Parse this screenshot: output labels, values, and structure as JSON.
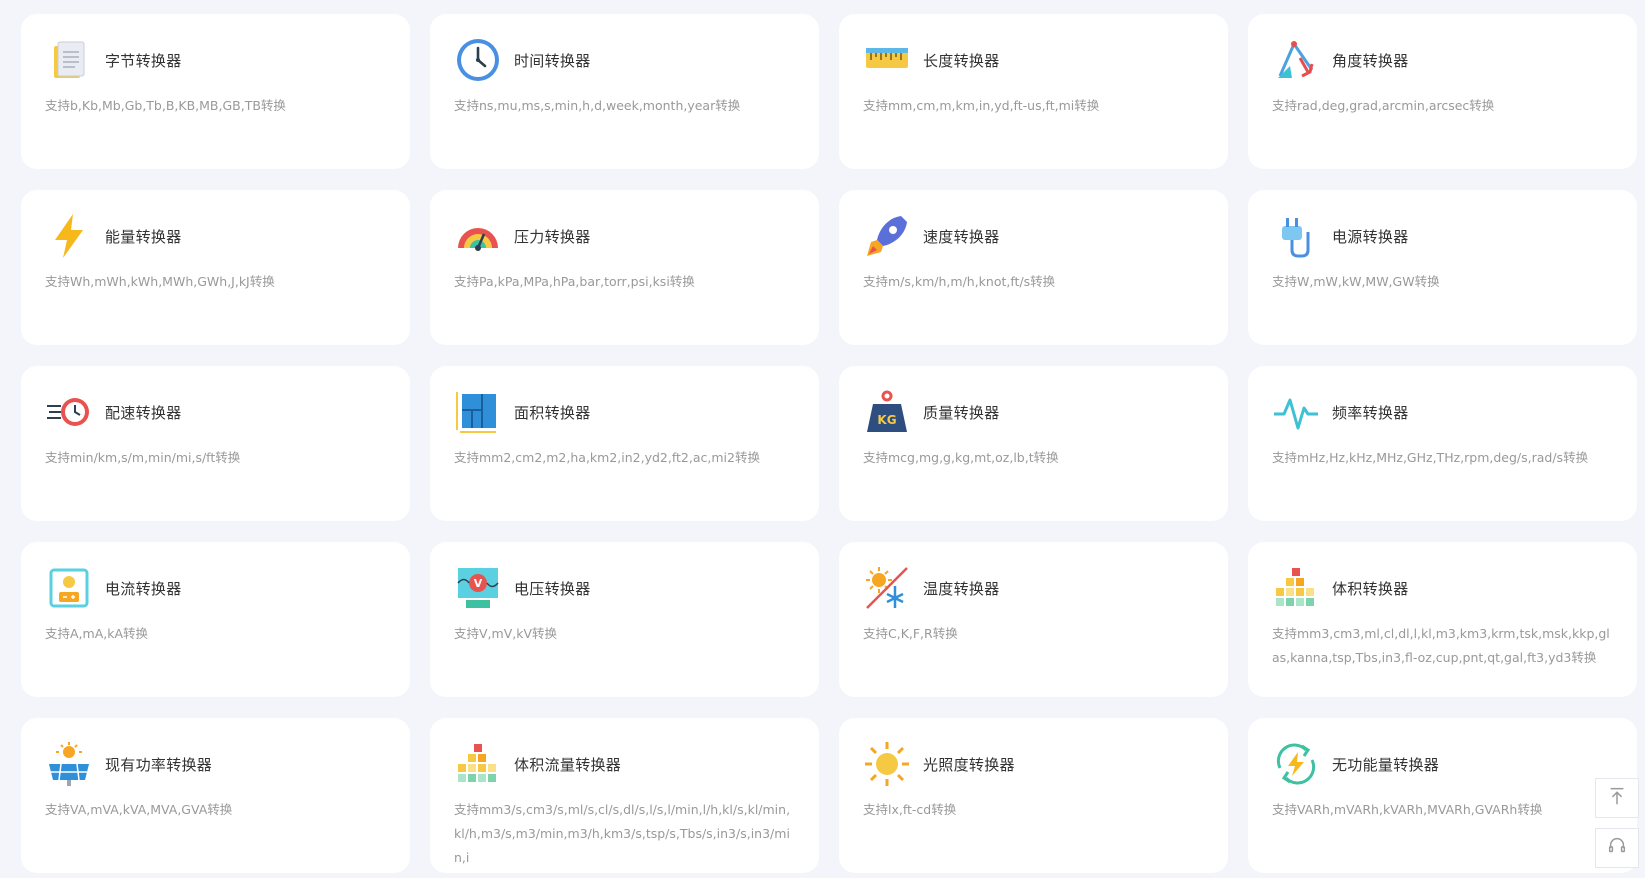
{
  "converters": [
    {
      "icon": "document-icon",
      "title": "字节转换器",
      "desc": "支持b,Kb,Mb,Gb,Tb,B,KB,MB,GB,TB转换"
    },
    {
      "icon": "clock-icon",
      "title": "时间转换器",
      "desc": "支持ns,mu,ms,s,min,h,d,week,month,year转换"
    },
    {
      "icon": "ruler-icon",
      "title": "长度转换器",
      "desc": "支持mm,cm,m,km,in,yd,ft-us,ft,mi转换"
    },
    {
      "icon": "angle-icon",
      "title": "角度转换器",
      "desc": "支持rad,deg,grad,arcmin,arcsec转换"
    },
    {
      "icon": "lightning-icon",
      "title": "能量转换器",
      "desc": "支持Wh,mWh,kWh,MWh,GWh,J,kJ转换"
    },
    {
      "icon": "gauge-icon",
      "title": "压力转换器",
      "desc": "支持Pa,kPa,MPa,hPa,bar,torr,psi,ksi转换"
    },
    {
      "icon": "rocket-icon",
      "title": "速度转换器",
      "desc": "支持m/s,km/h,m/h,knot,ft/s转换"
    },
    {
      "icon": "plug-icon",
      "title": "电源转换器",
      "desc": "支持W,mW,kW,MW,GW转换"
    },
    {
      "icon": "stopwatch-icon",
      "title": "配速转换器",
      "desc": "支持min/km,s/m,min/mi,s/ft转换"
    },
    {
      "icon": "floorplan-icon",
      "title": "面积转换器",
      "desc": "支持mm2,cm2,m2,ha,km2,in2,yd2,ft2,ac,mi2转换"
    },
    {
      "icon": "kg-weight-icon",
      "title": "质量转换器",
      "desc": "支持mcg,mg,g,kg,mt,oz,lb,t转换"
    },
    {
      "icon": "pulse-icon",
      "title": "频率转换器",
      "desc": "支持mHz,Hz,kHz,MHz,GHz,THz,rpm,deg/s,rad/s转换"
    },
    {
      "icon": "battery-icon",
      "title": "电流转换器",
      "desc": "支持A,mA,kA转换"
    },
    {
      "icon": "voltmeter-icon",
      "title": "电压转换器",
      "desc": "支持V,mV,kV转换"
    },
    {
      "icon": "temperature-icon",
      "title": "温度转换器",
      "desc": "支持C,K,F,R转换"
    },
    {
      "icon": "blocks-icon",
      "title": "体积转换器",
      "desc": "支持mm3,cm3,ml,cl,dl,l,kl,m3,km3,krm,tsk,msk,kkp,glas,kanna,tsp,Tbs,in3,fl-oz,cup,pnt,qt,gal,ft3,yd3转换"
    },
    {
      "icon": "solar-panel-icon",
      "title": "现有功率转换器",
      "desc": "支持VA,mVA,kVA,MVA,GVA转换"
    },
    {
      "icon": "blocks-icon",
      "title": "体积流量转换器",
      "desc": "支持mm3/s,cm3/s,ml/s,cl/s,dl/s,l/s,l/min,l/h,kl/s,kl/min,kl/h,m3/s,m3/min,m3/h,km3/s,tsp/s,Tbs/s,in3/s,in3/min,i"
    },
    {
      "icon": "sun-icon",
      "title": "光照度转换器",
      "desc": "支持lx,ft-cd转换"
    },
    {
      "icon": "recycle-energy-icon",
      "title": "无功能量转换器",
      "desc": "支持VARh,mVARh,kVARh,MVARh,GVARh转换"
    }
  ],
  "floating": {
    "top_icon": "arrow-up-icon",
    "support_icon": "headset-icon"
  }
}
